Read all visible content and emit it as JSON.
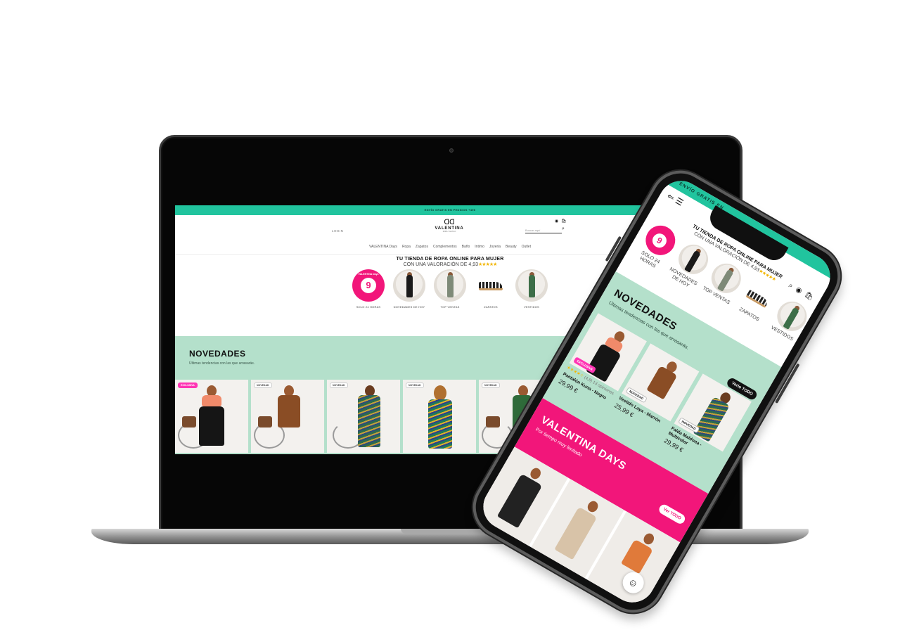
{
  "banner": {
    "text": "ENVÍO GRATIS EN PEDIDOS +49€",
    "phone_text": "ENVÍO GRATIS EN"
  },
  "header": {
    "left_label": "LOGIN",
    "logo_mark": "ᗡᗡ",
    "logo_name": "VALENTINA",
    "logo_sub": "ROPA Y ESTILO",
    "search_placeholder": "Buscar aquí"
  },
  "nav": {
    "items": [
      "VALENTINA Days",
      "Ropa",
      "Zapatos",
      "Complementos",
      "Baño",
      "Intimo",
      "Joyeria",
      "Beauty",
      "Outlet"
    ]
  },
  "tagline": {
    "line1": "TU TIENDA DE ROPA ONLINE PARA MUJER",
    "line2": "CON UNA VALORACIÓN DE 4,93",
    "stars": "★★★★★"
  },
  "categories": [
    {
      "label": "SOLO 24 HORAS",
      "badge_line": "VALENTINA Days",
      "badge_value": "9"
    },
    {
      "label": "NOVEDADES DE HOY"
    },
    {
      "label": "TOP VENTAS"
    },
    {
      "label": "ZAPATOS"
    },
    {
      "label": "VESTIDOS"
    }
  ],
  "novedades": {
    "title": "NOVEDADES",
    "subtitle": "Últimas tendencias con las que arrasarás.",
    "view_all": "Verlo TODO",
    "badges": [
      "EXCLUSIVA",
      "NOVEDAD",
      "NOVEDAD",
      "NOVEDAD",
      "NOVEDAD"
    ],
    "products": [
      {
        "name": "Pantalón Kuna - Negro",
        "price": "29,99 €",
        "stars": "★★★★☆",
        "reviews": "(4,8) 13 opiniones",
        "badge": "EXCLUSIVA"
      },
      {
        "name": "Vestido Laya - Marrón",
        "price": "25,99 €",
        "badge": "NOVEDAD"
      },
      {
        "name": "Falda Maldona - Multicolor",
        "price": "29,99 €",
        "badge": "NOVEDAD"
      }
    ]
  },
  "days": {
    "title": "VALENTINA DAYS",
    "subtitle": "Por tiempo muy limitado",
    "view_all": "Ver TODO"
  },
  "colors": {
    "accent": "#21c49e",
    "mint": "#b4e0cb",
    "pink": "#f2167a"
  },
  "icons": [
    "account-icon",
    "bag-icon",
    "search-icon",
    "back-arrow-icon",
    "menu-icon",
    "chat-icon"
  ]
}
